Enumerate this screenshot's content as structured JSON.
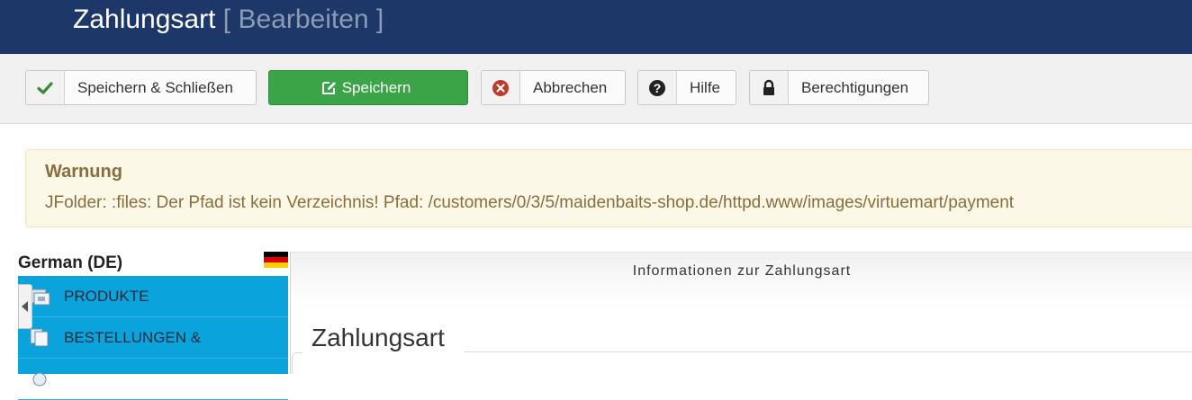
{
  "header": {
    "title": "Zahlungsart",
    "subtitle": "[ Bearbeiten ]"
  },
  "toolbar": {
    "save_close_label": "Speichern & Schließen",
    "save_label": "Speichern",
    "cancel_label": "Abbrechen",
    "help_label": "Hilfe",
    "permissions_label": "Berechtigungen"
  },
  "alert": {
    "heading": "Warnung",
    "message": "JFolder: :files: Der Pfad ist kein Verzeichnis! Pfad: /customers/0/3/5/maidenbaits-shop.de/httpd.www/images/virtuemart/payment"
  },
  "sidebar": {
    "language_label": "German (DE)",
    "items": [
      {
        "label": "PRODUKTE",
        "icon": "products-icon"
      },
      {
        "label": "BESTELLUNGEN &",
        "icon": "orders-icon"
      },
      {
        "label": "",
        "icon": "settings-icon"
      }
    ]
  },
  "main": {
    "panel_title": "Informationen zur Zahlungsart",
    "section_title": "Zahlungsart"
  },
  "colors": {
    "header_bg": "#1c3768",
    "success_green": "#3aa447",
    "alert_text": "#8a6d3b",
    "menu_blue": "#0aa3dc"
  }
}
